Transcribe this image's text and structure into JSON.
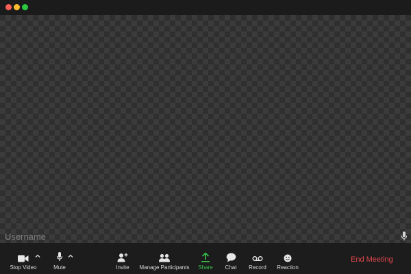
{
  "window": {
    "traffic_colors": {
      "close": "#ff5f57",
      "minimize": "#febc2e",
      "maximize": "#28c840"
    }
  },
  "video": {
    "username": "Username"
  },
  "toolbar": {
    "stop_video": "Stop Video",
    "mute": "Mute",
    "invite": "Invite",
    "manage_participants": "Manage Participants",
    "share": "Share",
    "chat": "Chat",
    "record": "Record",
    "reaction": "Reaction",
    "end_meeting": "End Meeting"
  },
  "colors": {
    "share_accent": "#37c24b",
    "end_meeting": "#e5484d"
  },
  "icons": {
    "stop_video": "video-camera-icon",
    "mute": "microphone-icon",
    "invite": "add-person-icon",
    "manage_participants": "participants-icon",
    "share": "share-upload-icon",
    "chat": "chat-bubble-icon",
    "record": "record-icon",
    "reaction": "smiley-icon"
  }
}
